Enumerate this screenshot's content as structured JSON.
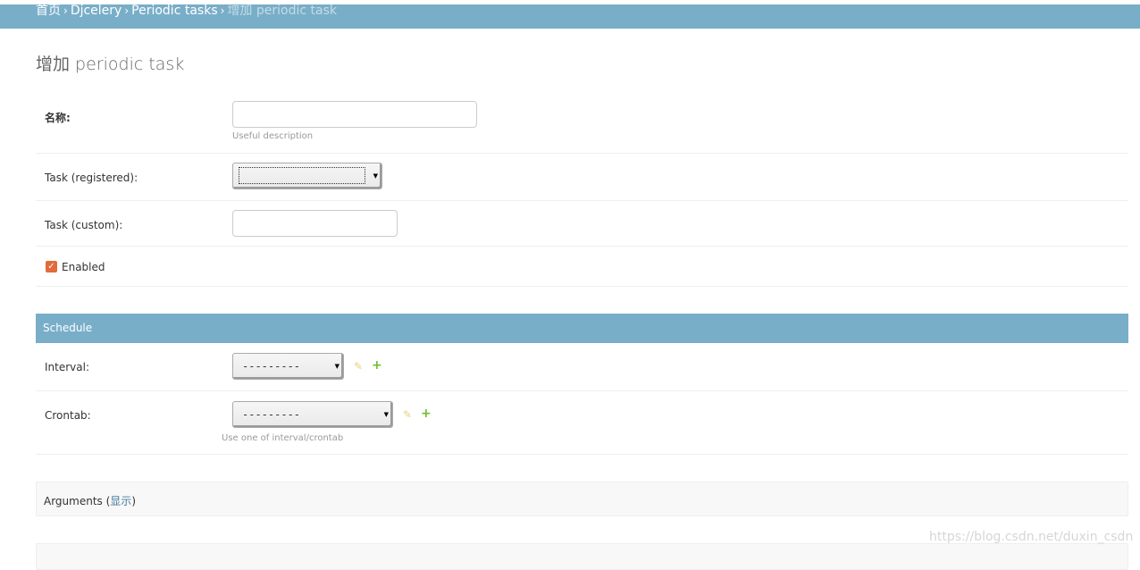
{
  "breadcrumbs": {
    "home": "首页",
    "app": "Djcelery",
    "model": "Periodic tasks",
    "current": "增加 periodic task",
    "separator": "›"
  },
  "page_title": "增加 periodic task",
  "form": {
    "name": {
      "label": "名称:",
      "value": "",
      "help": "Useful description"
    },
    "task_registered": {
      "label": "Task (registered):",
      "selected": ""
    },
    "task_custom": {
      "label": "Task (custom):",
      "value": ""
    },
    "enabled": {
      "label": "Enabled",
      "checked": true
    }
  },
  "schedule": {
    "title": "Schedule",
    "interval": {
      "label": "Interval:",
      "selected": "---------"
    },
    "crontab": {
      "label": "Crontab:",
      "selected": "---------",
      "help": "Use one of interval/crontab"
    }
  },
  "arguments": {
    "title": "Arguments",
    "toggle_label": "显示"
  },
  "icons": {
    "edit": "pencil-icon",
    "add": "plus-icon",
    "checkbox": "checkmark-icon"
  },
  "colors": {
    "header_bar": "#79aec8",
    "checkbox": "#e26a3c",
    "add_icon": "#70bf2b",
    "edit_icon": "#e7d27a"
  },
  "watermark": "https://blog.csdn.net/duxin_csdn"
}
